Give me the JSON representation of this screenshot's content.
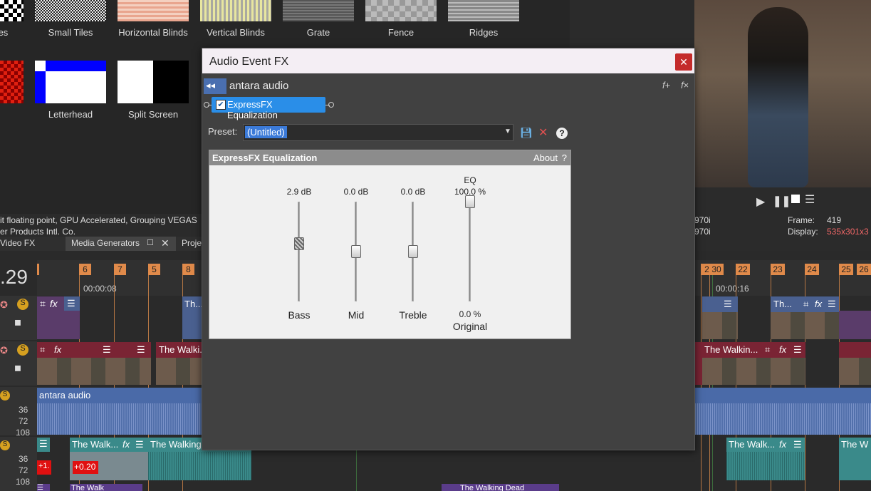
{
  "transitions": {
    "labels": [
      "les",
      "Small Tiles",
      "Horizontal Blinds",
      "Vertical Blinds",
      "Grate",
      "Fence",
      "Ridges",
      "Letterhead",
      "Split Screen"
    ]
  },
  "status": {
    "line1": "it floating point, GPU Accelerated, Grouping VEGAS",
    "line2": "er Products Intl. Co."
  },
  "tabs": {
    "video_fx": "Video FX",
    "media_generators": "Media Generators",
    "project": "Proje"
  },
  "preview": {
    "res1": "970i",
    "res2": "970i",
    "frame_label": "Frame:",
    "frame_value": "419",
    "display_label": "Display:",
    "display_value": "535x301x3"
  },
  "timeline": {
    "time_display": ".29",
    "time1": "00:00:08",
    "time2": "00:00:16",
    "markers": [
      "6",
      "7",
      "5",
      "8",
      "2",
      "30",
      "22",
      "23",
      "24",
      "25",
      "26"
    ],
    "clips": {
      "v1_left": "Th...",
      "v1_right": "Th...",
      "v2_walk1": "The Walki...",
      "v2_walk2": "The Walkin...",
      "audio_label": "antara audio",
      "a2_walk1": "The Walk...",
      "a2_walk2": "The Walking",
      "a2_walk3": "The Walk...",
      "a2_walk4": "The W",
      "a3_walk": "The Walking Dead",
      "a3_walk_left": "The Walk",
      "gain1": "+1.",
      "gain2": "+0.20"
    },
    "levels": [
      "36",
      "72",
      "108",
      "36",
      "72",
      "108"
    ]
  },
  "dialog": {
    "title": "Audio Event FX",
    "close": "✕",
    "chain_name": "antara audio",
    "plugin_name": "ExpressFX Equalization",
    "preset_label": "Preset:",
    "preset_value": "(Untitled)",
    "panel_title": "ExpressFX Equalization",
    "about": "About",
    "help": "?",
    "eq_title": "EQ",
    "sliders": [
      {
        "name": "Bass",
        "value": "2.9 dB",
        "level": 0.58
      },
      {
        "name": "Mid",
        "value": "0.0 dB",
        "level": 0.5
      },
      {
        "name": "Treble",
        "value": "0.0 dB",
        "level": 0.5
      },
      {
        "name": "Original",
        "value": "0.0 %",
        "eq_value": "100.0 %",
        "level": 1.0
      }
    ]
  },
  "colors": {
    "accent": "#2a8ee8",
    "close": "#c42b2b",
    "marker": "#e08a4a"
  }
}
